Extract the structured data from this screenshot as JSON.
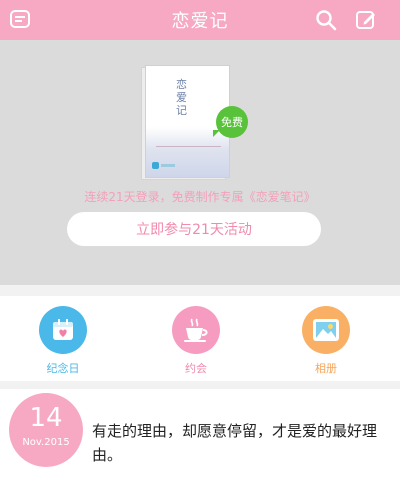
{
  "header": {
    "title": "恋爱记",
    "left_icon": "chat-list-icon",
    "search_icon": "search-icon",
    "edit_icon": "edit-icon"
  },
  "promo": {
    "book_title": "恋爱记",
    "badge": "免费",
    "text": "连续21天登录，免费制作专属《恋爱笔记》",
    "button": "立即参与21天活动"
  },
  "categories": [
    {
      "label": "纪念日",
      "icon": "calendar-heart-icon",
      "color": "#4ab8e8"
    },
    {
      "label": "约会",
      "icon": "coffee-cup-icon",
      "color": "#f59cc0"
    },
    {
      "label": "相册",
      "icon": "photo-icon",
      "color": "#f9b064"
    }
  ],
  "quote": {
    "day": "14",
    "month": "Nov.2015",
    "text": "有走的理由，却愿意停留，才是爱的最好理由。"
  },
  "colors": {
    "accent": "#f7a9c4",
    "promo_bg": "#dbdbdb",
    "badge_green": "#58c23a"
  }
}
